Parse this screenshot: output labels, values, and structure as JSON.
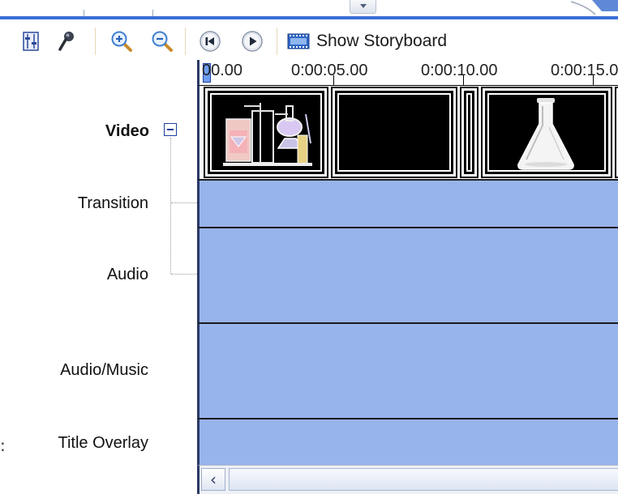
{
  "toolbar": {
    "storyboard_label": "Show Storyboard",
    "buttons": [
      {
        "name": "set-audio-levels",
        "icon": "audio-levels-icon"
      },
      {
        "name": "narrate-timeline",
        "icon": "microphone-icon"
      },
      {
        "name": "zoom-in",
        "icon": "zoom-in-icon"
      },
      {
        "name": "zoom-out",
        "icon": "zoom-out-icon"
      },
      {
        "name": "rewind",
        "icon": "rewind-icon"
      },
      {
        "name": "play",
        "icon": "play-icon"
      }
    ]
  },
  "tracks": {
    "video": "Video",
    "transition": "Transition",
    "audio": "Audio",
    "audio_music": "Audio/Music",
    "title_overlay": "Title Overlay"
  },
  "ruler": {
    "labels": [
      "00.00",
      "0:00:05.00",
      "0:00:10.00",
      "0:00:15.0"
    ]
  },
  "clips": [
    {
      "name": "clip-lab-apparatus",
      "content": "lab-apparatus-image"
    },
    {
      "name": "clip-black",
      "content": "black-frame"
    },
    {
      "name": "clip-narrow",
      "content": "black-frame"
    },
    {
      "name": "clip-flask",
      "content": "flask-image"
    }
  ],
  "colors": {
    "track_bg": "#98b4ec",
    "accent": "#3a6fd8"
  }
}
